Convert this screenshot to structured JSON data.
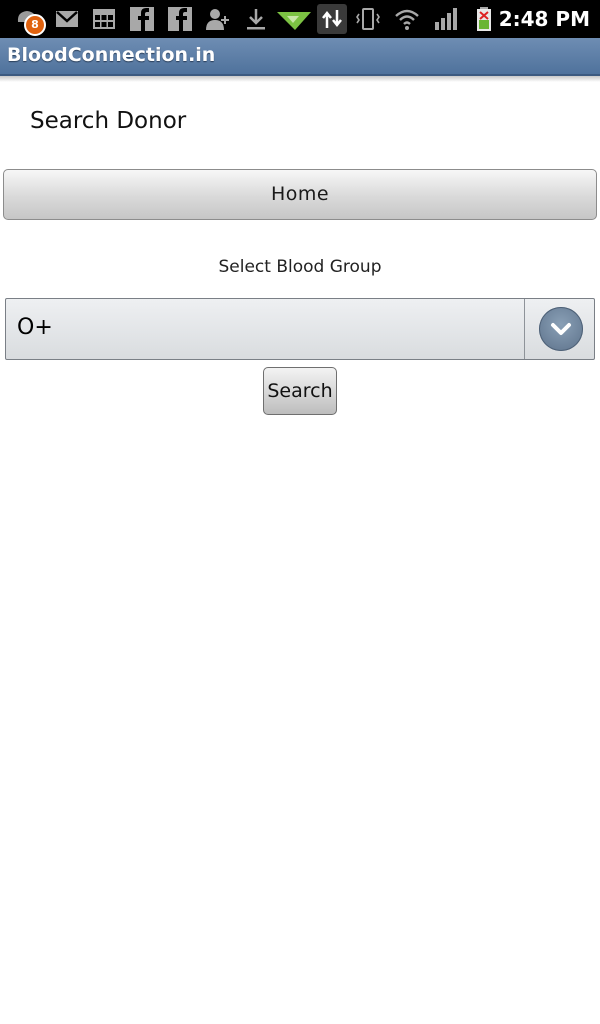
{
  "status_bar": {
    "notification_count": "8",
    "time": "2:48 PM",
    "icons": [
      "notification-icon",
      "gmail-icon",
      "calendar-icon",
      "facebook-icon",
      "facebook-icon",
      "add-contact-icon",
      "download-icon",
      "android-market-icon",
      "sync-icon",
      "vibrate-icon",
      "wifi-icon",
      "signal-icon",
      "battery-icon"
    ]
  },
  "app": {
    "title": "BloodConnection.in"
  },
  "page": {
    "heading": "Search Donor",
    "home_label": "Home",
    "select_label": "Select Blood Group",
    "selected_blood_group": "O+",
    "search_label": "Search"
  },
  "colors": {
    "title_bar": "#5a7aa3",
    "badge": "#e0620f",
    "dropdown_arrow": "#6f8399"
  }
}
